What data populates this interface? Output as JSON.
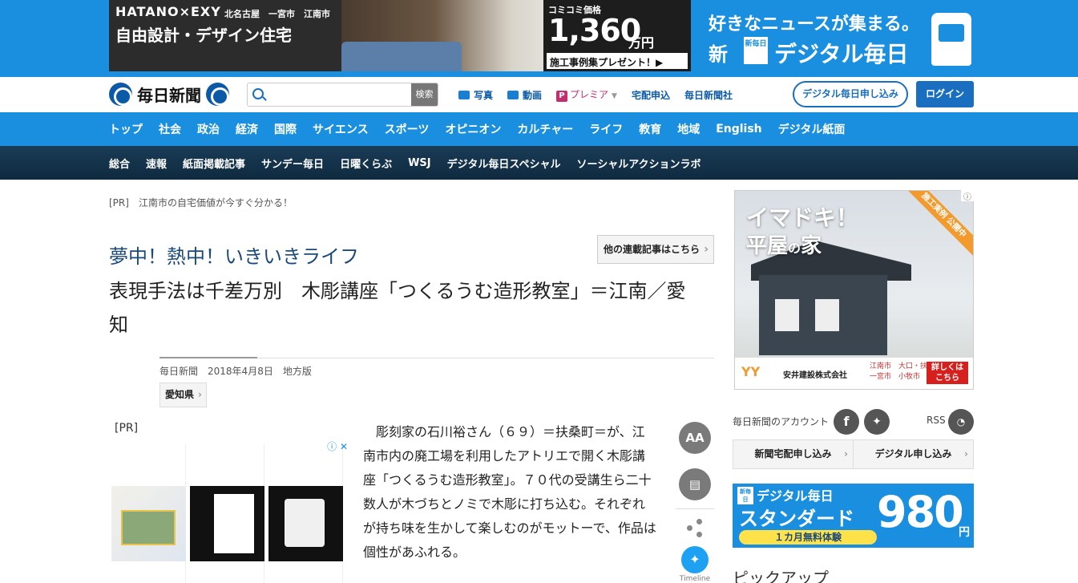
{
  "top_ad": {
    "brand": "HATANO×EXY",
    "cities": "北名古屋　一宮市　江南市",
    "slogan": "自由設計・デザイン住宅",
    "price_label": "コミコミ価格",
    "price": "1,360",
    "price_unit": "万円",
    "cta": "施工事例集プレゼント！▶",
    "info": "i"
  },
  "digital_ad": {
    "line1": "好きなニュースが集まる。",
    "new": "新",
    "badge": "新毎日",
    "name": "デジタル毎日"
  },
  "header": {
    "logo": "毎日新聞",
    "search_placeholder": "",
    "search_button": "検索",
    "links": [
      "写真",
      "動画",
      "プレミア",
      "宅配申込",
      "毎日新聞社"
    ],
    "premier_icon": "P",
    "digital_button": "デジタル毎日申し込み",
    "login_button": "ログイン"
  },
  "nav_main": [
    "トップ",
    "社会",
    "政治",
    "経済",
    "国際",
    "サイエンス",
    "スポーツ",
    "オピニオン",
    "カルチャー",
    "ライフ",
    "教育",
    "地域",
    "English",
    "デジタル紙面"
  ],
  "nav_sub": [
    "総合",
    "速報",
    "紙面掲載記事",
    "サンデー毎日",
    "日曜くらぶ",
    "WSJ",
    "デジタル毎日スペシャル",
    "ソーシャルアクションラボ"
  ],
  "article": {
    "pr_line": "[PR]　江南市の自宅価値が今すぐ分かる！",
    "series": "夢中！熱中！いきいきライフ",
    "series_link": "他の連載記事はこちら",
    "headline": "表現手法は千差万別　木彫講座「つくるうむ造形教室」＝江南／愛知",
    "source": "毎日新聞",
    "date": "2018年4月8日",
    "edition": "地方版",
    "tag": "愛知県",
    "pr_block": "[PR]",
    "body": "彫刻家の石川裕さん（６９）＝扶桑町＝が、江南市内の廃工場を利用したアトリエで開く木彫講座「つくるうむ造形教室」。７０代の受講生ら二十数人が木づちとノミで木彫に打ち込む。それぞれが持ち味を生かして楽しむのがモットーで、作品は個性があふれる。"
  },
  "tools": {
    "font_size": "AA",
    "twitter_label": "Timeline"
  },
  "sidebar": {
    "ad_title1": "イマドキ！",
    "ad_title2a": "平屋",
    "ad_title2b": "の",
    "ad_title2c": "家",
    "ad_ribbon": "施工実例 公開中",
    "ad_company": "安井建設株式会社",
    "ad_logo": "YY",
    "ad_areas": "江南市　大口・扶桑\n一宮市　小牧市",
    "ad_more": "詳しくは\nこちら",
    "account_label": "毎日新聞のアカウント",
    "rss_label": "RSS",
    "sub_buttons": [
      "新聞宅配申し込み",
      "デジタル申し込み"
    ],
    "digi_badge": "新毎日",
    "digi_title": "デジタル毎日",
    "digi_plan": "スタンダード",
    "digi_free": "１カ月無料体験",
    "digi_price": "980",
    "digi_yen": "円",
    "pickup": "ピックアップ"
  }
}
